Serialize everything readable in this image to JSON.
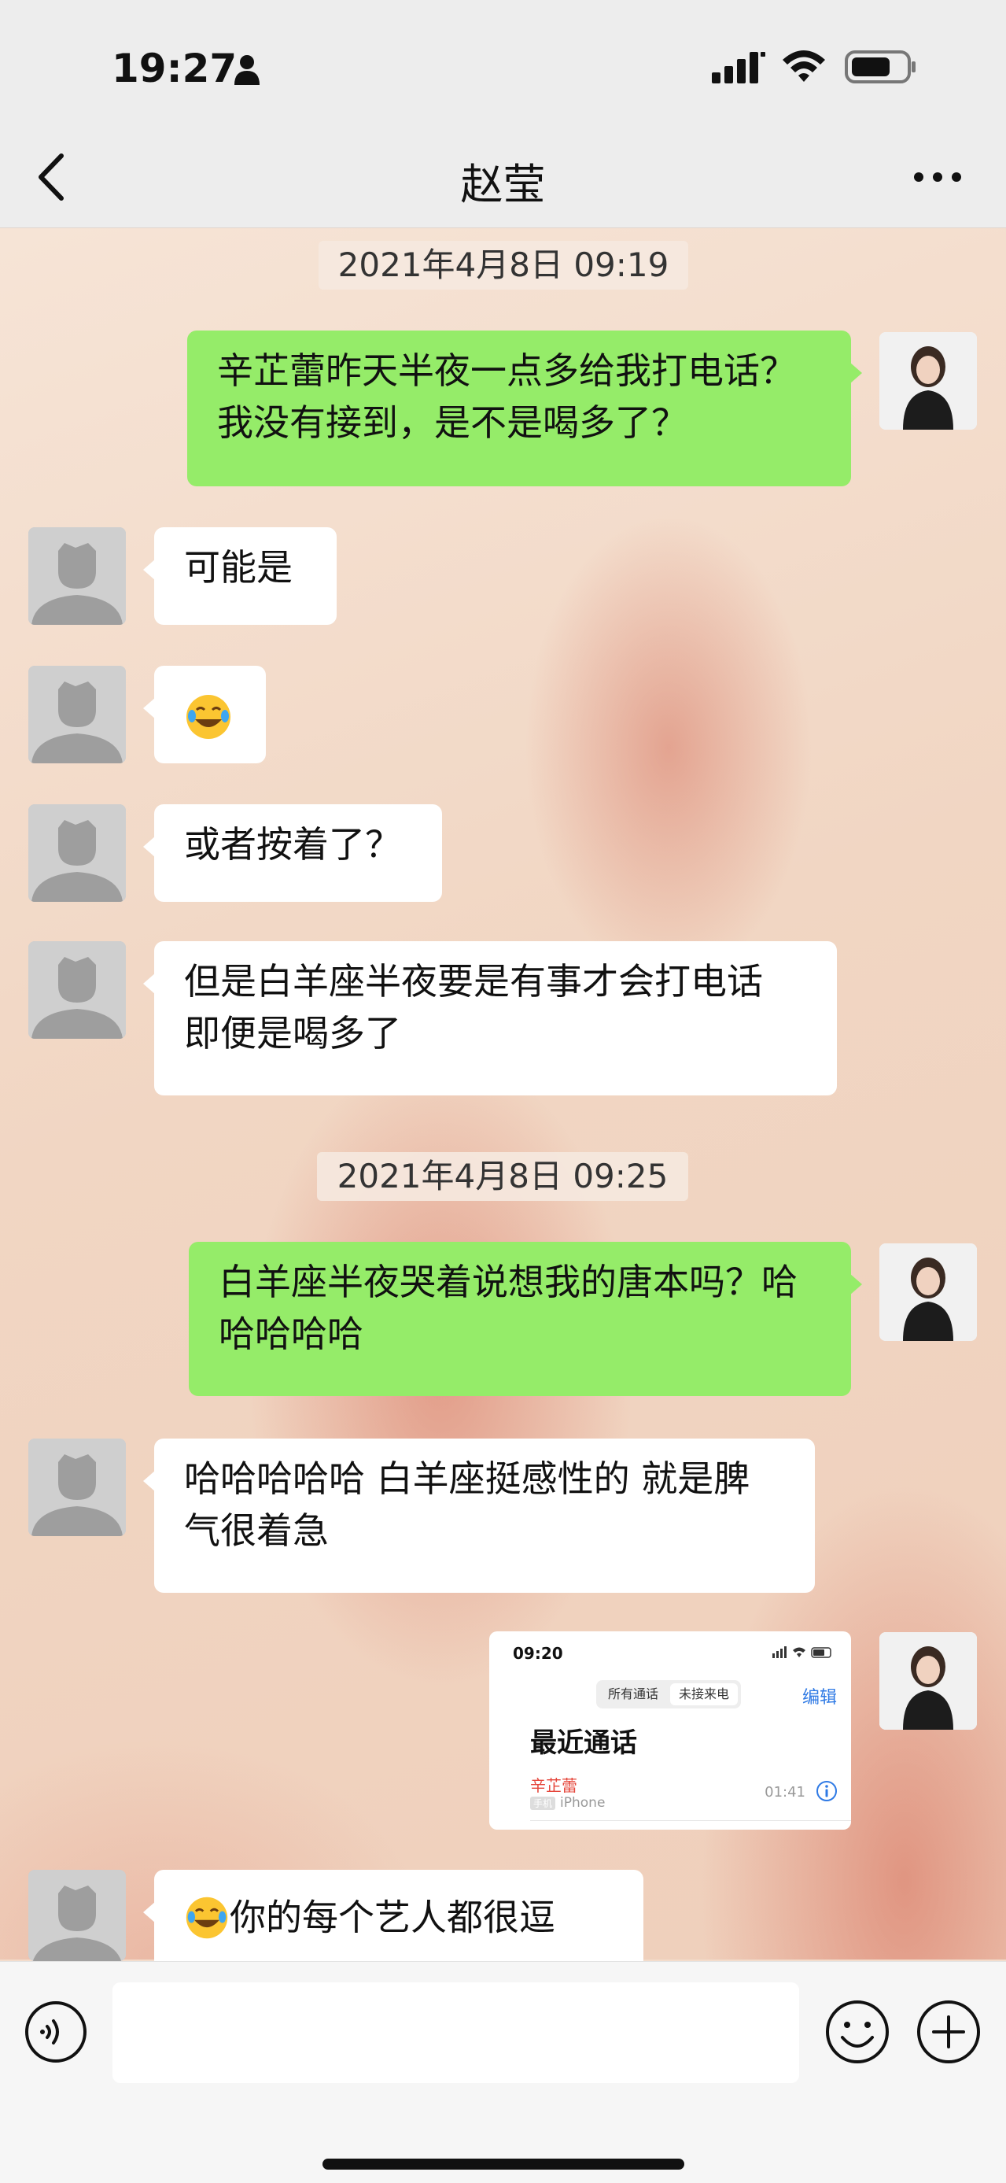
{
  "status_bar": {
    "time": "19:27",
    "icons": [
      "person-icon",
      "signal-icon",
      "wifi-icon",
      "battery-icon"
    ]
  },
  "nav": {
    "title": "赵莹",
    "back_icon": "chevron-left-icon",
    "more_icon": "more-dots-icon"
  },
  "messages": [
    {
      "type": "timestamp",
      "text": "2021年4月8日 09:19"
    },
    {
      "type": "outgoing",
      "text": "辛芷蕾昨天半夜一点多给我打电话？我没有接到，是不是喝多了？"
    },
    {
      "type": "incoming",
      "text": "可能是"
    },
    {
      "type": "incoming",
      "emoji": "tears-of-joy-emoji"
    },
    {
      "type": "incoming",
      "text": "或者按着了？"
    },
    {
      "type": "incoming",
      "text": "但是白羊座半夜要是有事才会打电话 即便是喝多了"
    },
    {
      "type": "timestamp",
      "text": "2021年4月8日 09:25"
    },
    {
      "type": "outgoing",
      "text": "白羊座半夜哭着说想我的唐本吗？哈哈哈哈哈"
    },
    {
      "type": "incoming",
      "text": "哈哈哈哈哈 白羊座挺感性的 就是脾气很着急"
    },
    {
      "type": "outgoing",
      "image": "call-log-screenshot"
    },
    {
      "type": "incoming",
      "emoji": "tears-of-joy-emoji",
      "text": "你的每个艺人都很逗"
    }
  ],
  "screenshot": {
    "time": "09:20",
    "tab_all": "所有通话",
    "tab_missed": "未接来电",
    "edit": "编辑",
    "title": "最近通话",
    "caller": "辛芷蕾",
    "tag": "手机",
    "device": "iPhone",
    "duration": "01:41"
  },
  "input_bar": {
    "voice_icon": "voice-icon",
    "emoji_icon": "emoji-icon",
    "plus_icon": "plus-icon",
    "placeholder": ""
  },
  "colors": {
    "outgoing_bubble": "#95ec69",
    "incoming_bubble": "#ffffff",
    "nav_bg": "#ededed",
    "missed_call": "#e5453a",
    "link_blue": "#2f7ae5"
  }
}
